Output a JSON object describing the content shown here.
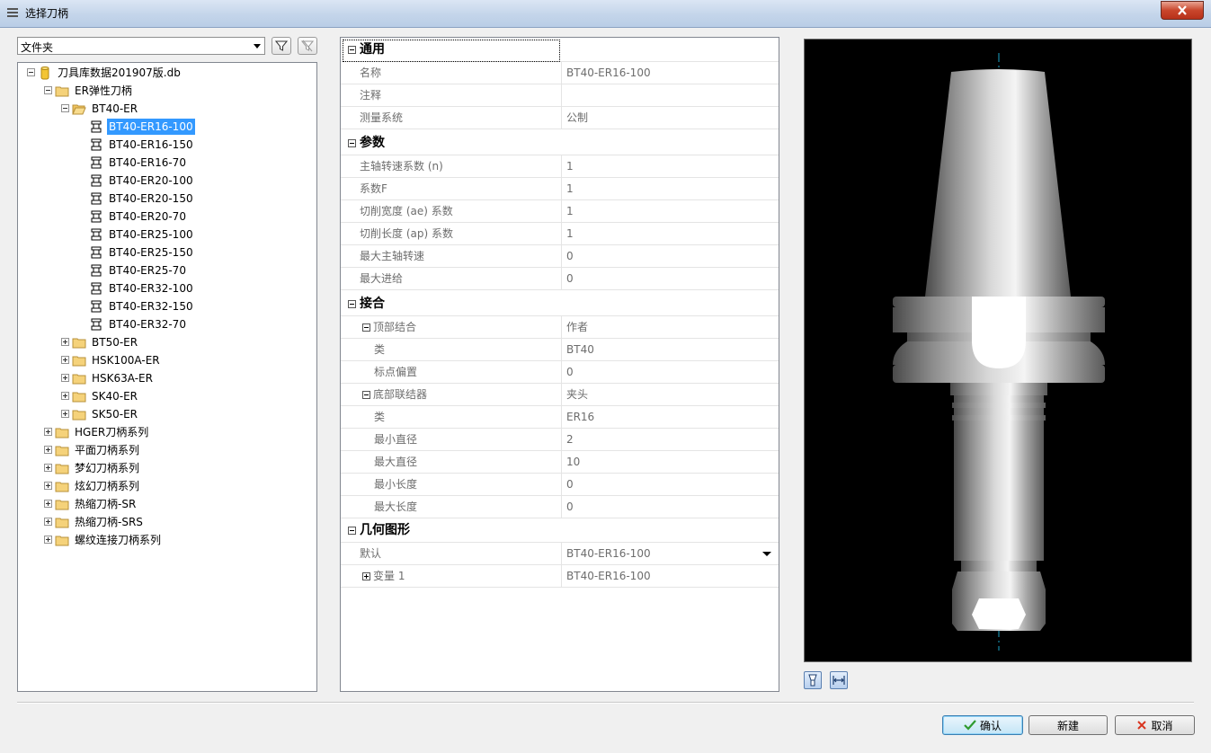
{
  "window": {
    "title": "选择刀柄"
  },
  "toolbar": {
    "folder_select_value": "文件夹"
  },
  "tree": {
    "root": "刀具库数据201907版.db",
    "er_group": "ER弹性刀柄",
    "bt40_group": "BT40-ER",
    "bt40_items": [
      "BT40-ER16-100",
      "BT40-ER16-150",
      "BT40-ER16-70",
      "BT40-ER20-100",
      "BT40-ER20-150",
      "BT40-ER20-70",
      "BT40-ER25-100",
      "BT40-ER25-150",
      "BT40-ER25-70",
      "BT40-ER32-100",
      "BT40-ER32-150",
      "BT40-ER32-70"
    ],
    "er_subgroups": [
      "BT50-ER",
      "HSK100A-ER",
      "HSK63A-ER",
      "SK40-ER",
      "SK50-ER"
    ],
    "top_groups": [
      "HGER刀柄系列",
      "平面刀柄系列",
      "梦幻刀柄系列",
      "炫幻刀柄系列",
      "热缩刀柄-SR",
      "热缩刀柄-SRS",
      "螺纹连接刀柄系列"
    ],
    "selected": "BT40-ER16-100"
  },
  "properties": {
    "general": {
      "title": "通用",
      "rows": [
        {
          "name": "名称",
          "value": "BT40-ER16-100"
        },
        {
          "name": "注释",
          "value": ""
        },
        {
          "name": "测量系统",
          "value": "公制"
        }
      ]
    },
    "params": {
      "title": "参数",
      "rows": [
        {
          "name": "主轴转速系数 (n)",
          "value": "1"
        },
        {
          "name": "系数F",
          "value": "1"
        },
        {
          "name": "切削宽度 (ae) 系数",
          "value": "1"
        },
        {
          "name": "切削长度 (ap) 系数",
          "value": "1"
        },
        {
          "name": "最大主轴转速",
          "value": "0"
        },
        {
          "name": "最大进给",
          "value": "0"
        }
      ]
    },
    "coupling": {
      "title": "接合",
      "top": {
        "name": "顶部结合",
        "value": "作者"
      },
      "top_rows": [
        {
          "name": "类",
          "value": "BT40"
        },
        {
          "name": "标点偏置",
          "value": "0"
        }
      ],
      "bottom": {
        "name": "底部联结器",
        "value": "夹头"
      },
      "bottom_rows": [
        {
          "name": "类",
          "value": "ER16"
        },
        {
          "name": "最小直径",
          "value": "2"
        },
        {
          "name": "最大直径",
          "value": "10"
        },
        {
          "name": "最小长度",
          "value": "0"
        },
        {
          "name": "最大长度",
          "value": "0"
        }
      ]
    },
    "geometry": {
      "title": "几何图形",
      "default": {
        "name": "默认",
        "value": "BT40-ER16-100"
      },
      "variant": {
        "name": "变量 1",
        "value": "BT40-ER16-100"
      }
    }
  },
  "buttons": {
    "ok": "确认",
    "new": "新建",
    "cancel": "取消"
  },
  "icons": {
    "filter": "filter-icon",
    "filter_clear": "filter-clear-icon",
    "view_holder": "view-holder-icon",
    "fit_width": "fit-width-icon"
  },
  "colors": {
    "selection": "#3399ff",
    "preview_bg": "#000000",
    "close_button": "#c9462c"
  }
}
